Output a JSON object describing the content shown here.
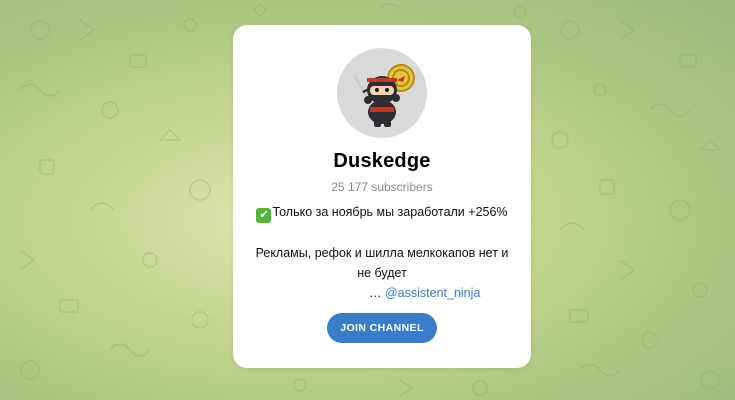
{
  "channel": {
    "name": "Duskedge",
    "subscribers": "25 177 subscribers",
    "avatar_icon": "ninja-mascot-icon"
  },
  "description": {
    "check_icon": "check-mark-emoji-icon",
    "line1": "Только за ноябрь мы заработали +256%",
    "line2": "Рекламы, рефок и шилла мелкокапов нет и не будет",
    "ellipsis": "…",
    "mention": "@assistent_ninja"
  },
  "actions": {
    "join_label": "JOIN CHANNEL"
  },
  "colors": {
    "accent": "#3a7cc8",
    "link": "#3a7cc4",
    "background": "#c7d690",
    "card": "#ffffff"
  }
}
